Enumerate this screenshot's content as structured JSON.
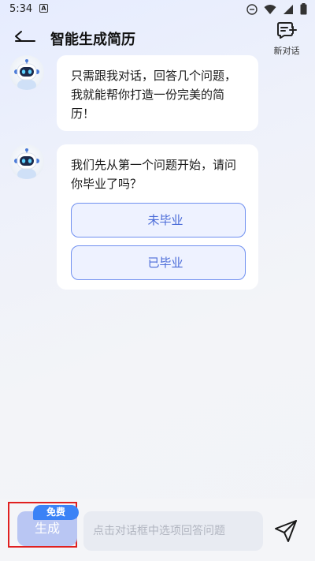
{
  "status": {
    "time": "5:34",
    "notice": "A"
  },
  "header": {
    "title": "智能生成简历",
    "new_chat_label": "新对话"
  },
  "messages": [
    {
      "text": "只需跟我对话，回答几个问题，我就能帮你打造一份完美的简历！"
    },
    {
      "text": "我们先从第一个问题开始，请问你毕业了吗？",
      "options": [
        "未毕业",
        "已毕业"
      ]
    }
  ],
  "bottom": {
    "generate_label": "生成",
    "free_badge": "免费",
    "input_placeholder": "点击对话框中选项回答问题"
  },
  "colors": {
    "accent": "#4a6bd8",
    "option_bg": "#eef2ff",
    "badge": "#3b82f6",
    "highlight": "#e02020"
  }
}
